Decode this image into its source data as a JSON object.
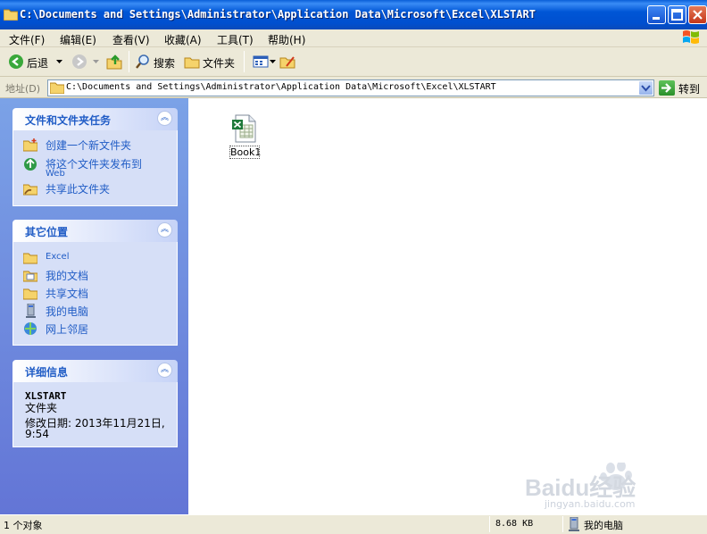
{
  "window": {
    "title": "C:\\Documents and Settings\\Administrator\\Application Data\\Microsoft\\Excel\\XLSTART"
  },
  "menu": [
    "文件(F)",
    "编辑(E)",
    "查看(V)",
    "收藏(A)",
    "工具(T)",
    "帮助(H)"
  ],
  "toolbar": {
    "back_label": "后退",
    "search_label": "搜索",
    "folders_label": "文件夹"
  },
  "address": {
    "label": "地址(D)",
    "value": "C:\\Documents and Settings\\Administrator\\Application Data\\Microsoft\\Excel\\XLSTART",
    "go_label": "转到"
  },
  "sidebar": {
    "tasks": {
      "title": "文件和文件夹任务",
      "items": [
        "创建一个新文件夹",
        "将这个文件夹发布到",
        "Web",
        "共享此文件夹"
      ]
    },
    "places": {
      "title": "其它位置",
      "items": [
        "Excel",
        "我的文档",
        "共享文档",
        "我的电脑",
        "网上邻居"
      ]
    },
    "details": {
      "title": "详细信息",
      "name": "XLSTART",
      "type": "文件夹",
      "modified": "修改日期: 2013年11月21日,",
      "modified_time": "9:54"
    }
  },
  "files": [
    {
      "name": "Book1",
      "icon": "excel-file-icon"
    }
  ],
  "status": {
    "count": "1 个对象",
    "size": "8.68 KB",
    "location": "我的电脑"
  },
  "watermark": {
    "text": "Baidu经验",
    "sub": "jingyan.baidu.com"
  },
  "colors": {
    "titlebar": "#0054e3",
    "sidebar": "#6f8fdf",
    "link": "#215dc6"
  }
}
